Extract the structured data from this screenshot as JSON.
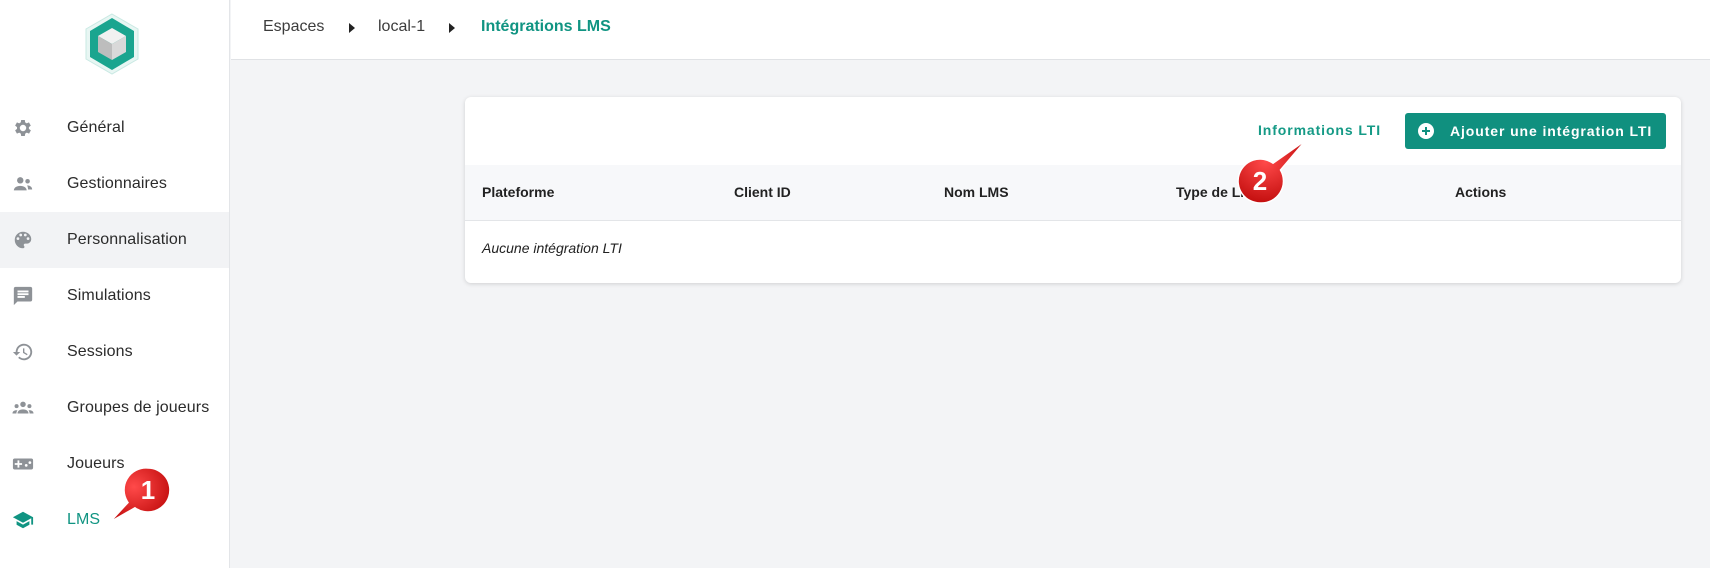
{
  "sidebar": {
    "logo_icon": "cube-logo-icon",
    "items": [
      {
        "label": "Général",
        "icon": "gear-icon"
      },
      {
        "label": "Gestionnaires",
        "icon": "people-icon"
      },
      {
        "label": "Personnalisation",
        "icon": "palette-icon"
      },
      {
        "label": "Simulations",
        "icon": "chat-icon"
      },
      {
        "label": "Sessions",
        "icon": "history-icon"
      },
      {
        "label": "Groupes de joueurs",
        "icon": "groups-icon"
      },
      {
        "label": "Joueurs",
        "icon": "gamepad-icon"
      },
      {
        "label": "LMS",
        "icon": "school-icon"
      }
    ]
  },
  "breadcrumb": {
    "items": [
      "Espaces",
      "local-1",
      "Intégrations LMS"
    ]
  },
  "card": {
    "info_link": "Informations LTI",
    "add_button": "Ajouter une intégration LTI",
    "columns": [
      "Plateforme",
      "Client ID",
      "Nom LMS",
      "Type de LMS",
      "Actions"
    ],
    "empty_text": "Aucune intégration LTI"
  },
  "callouts": [
    "1",
    "2"
  ],
  "colors": {
    "accent": "#109482",
    "callout": "#e21b1b"
  }
}
